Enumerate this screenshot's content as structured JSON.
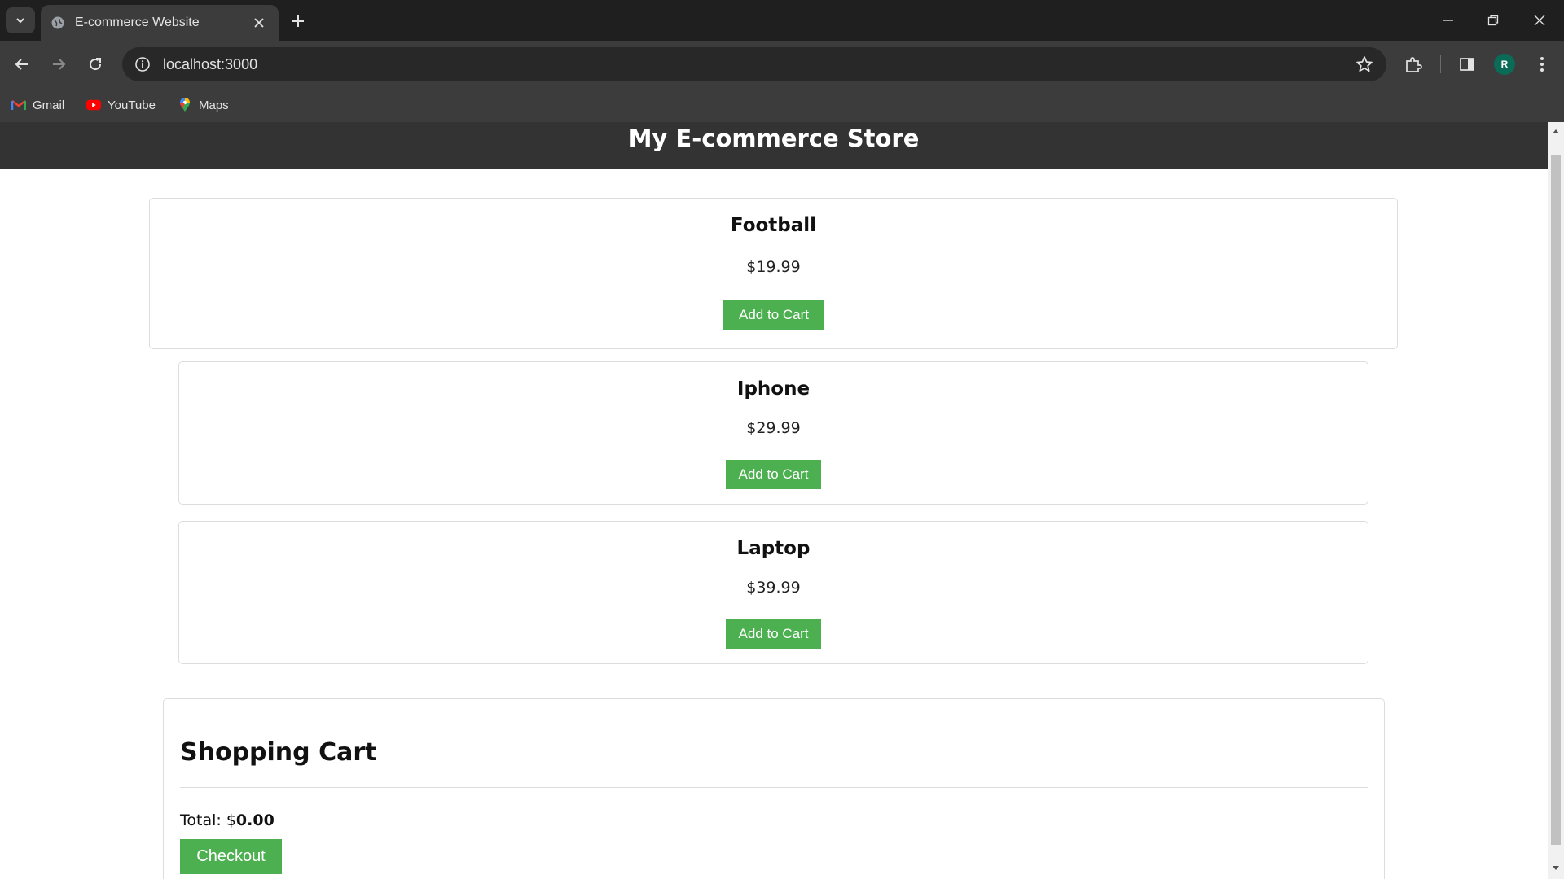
{
  "browser": {
    "tab_title": "E-commerce Website",
    "url": "localhost:3000",
    "bookmarks": [
      {
        "label": "Gmail",
        "icon": "gmail-icon"
      },
      {
        "label": "YouTube",
        "icon": "youtube-icon"
      },
      {
        "label": "Maps",
        "icon": "maps-icon"
      }
    ],
    "profile_initial": "R"
  },
  "site": {
    "title": "My E-commerce Store",
    "products": [
      {
        "name": "Football",
        "price": "$19.99",
        "button": "Add to Cart"
      },
      {
        "name": "Iphone",
        "price": "$29.99",
        "button": "Add to Cart"
      },
      {
        "name": "Laptop",
        "price": "$39.99",
        "button": "Add to Cart"
      }
    ],
    "cart": {
      "title": "Shopping Cart",
      "total_label": "Total: $",
      "total_value": "0.00",
      "checkout": "Checkout"
    }
  },
  "colors": {
    "header_bg": "#333333",
    "button_bg": "#4caf50"
  }
}
